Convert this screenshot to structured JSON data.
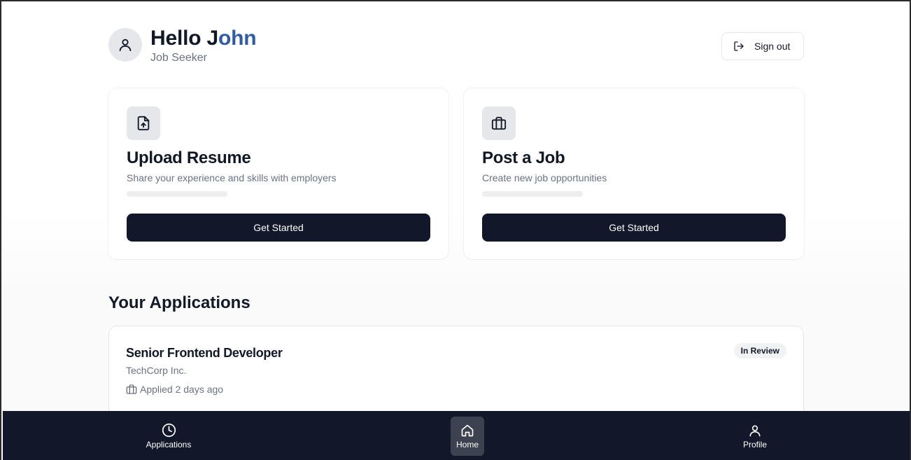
{
  "header": {
    "greeting_prefix": "Hello J",
    "greeting_name_highlight": "ohn",
    "role": "Job Seeker",
    "sign_out_label": "Sign out",
    "avatar_icon": "user-icon",
    "sign_out_icon": "log-out-icon"
  },
  "cards": [
    {
      "icon": "file-upload-icon",
      "title": "Upload Resume",
      "description": "Share your experience and skills with employers",
      "button_label": "Get Started"
    },
    {
      "icon": "briefcase-icon",
      "title": "Post a Job",
      "description": "Create new job opportunities",
      "button_label": "Get Started"
    }
  ],
  "applications": {
    "section_title": "Your Applications",
    "items": [
      {
        "title": "Senior Frontend Developer",
        "company": "TechCorp Inc.",
        "applied": "Applied 2 days ago",
        "status": "In Review"
      }
    ]
  },
  "bottom_nav": {
    "items": [
      {
        "label": "Applications",
        "icon": "clock-icon",
        "active": false
      },
      {
        "label": "Home",
        "icon": "home-icon",
        "active": true
      },
      {
        "label": "Profile",
        "icon": "user-icon",
        "active": false
      }
    ]
  },
  "colors": {
    "primary_dark": "#121829",
    "accent_blue": "#2f5aa8",
    "muted_text": "#6b7280"
  }
}
